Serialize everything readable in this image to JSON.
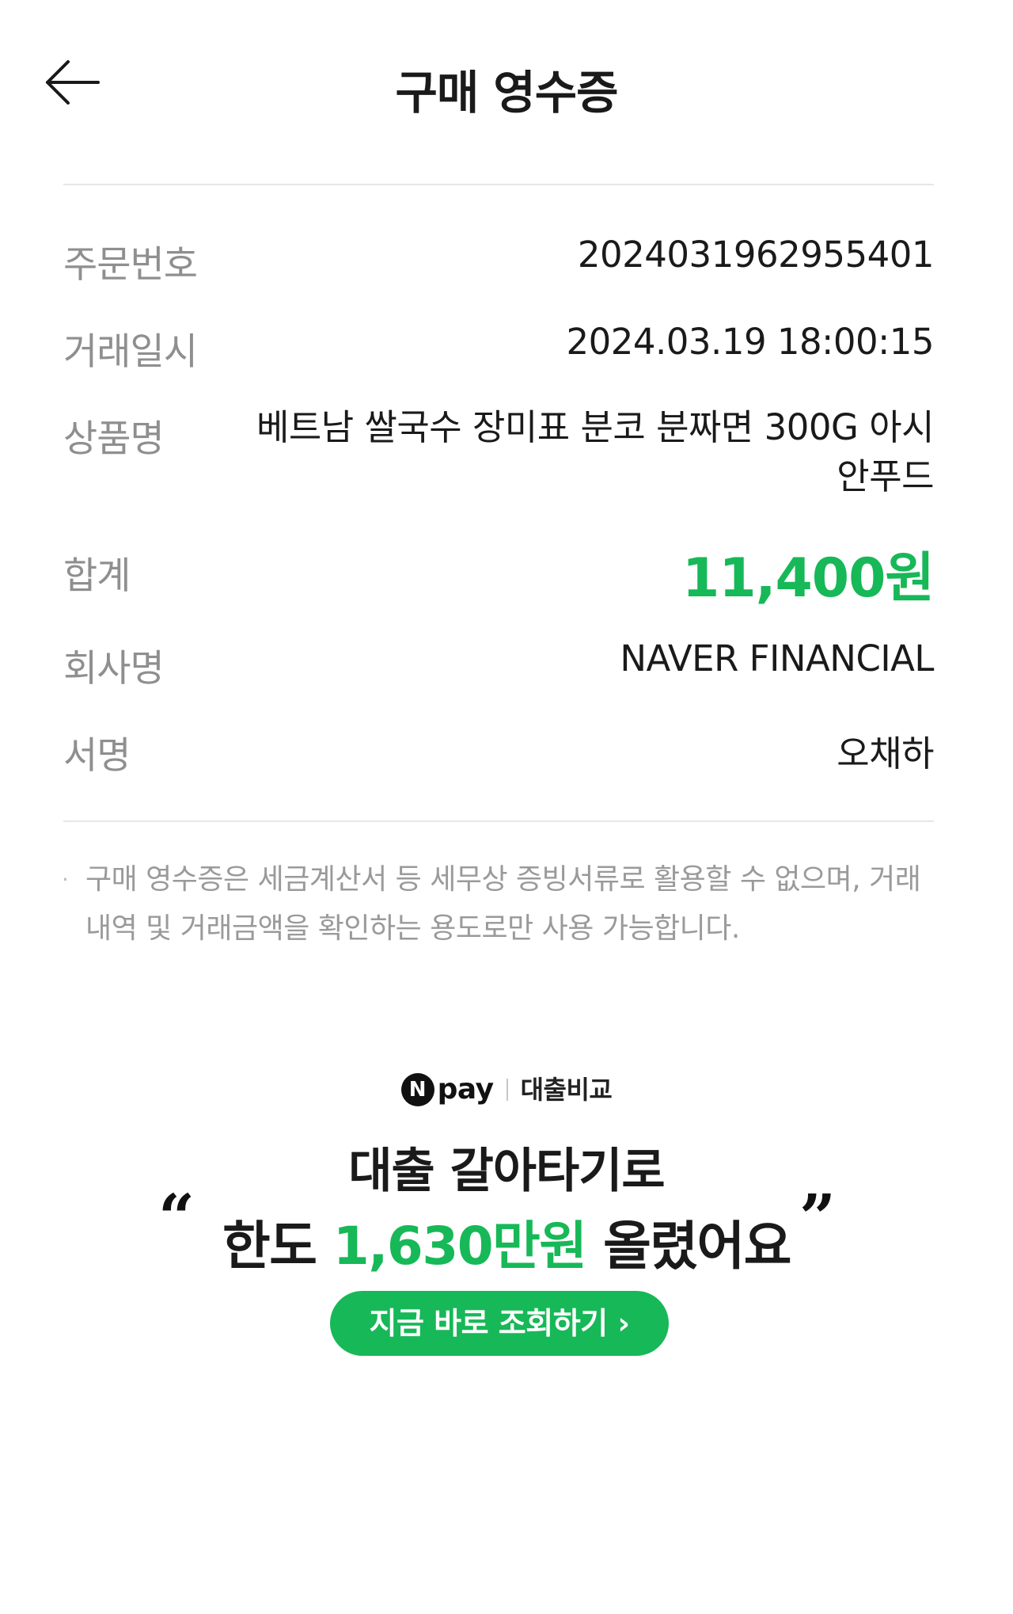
{
  "header": {
    "title": "구매 영수증"
  },
  "receipt": {
    "order_no": {
      "label": "주문번호",
      "value": "2024031962955401"
    },
    "datetime": {
      "label": "거래일시",
      "value": "2024.03.19 18:00:15"
    },
    "product": {
      "label": "상품명",
      "value": "베트남 쌀국수 장미표 분코 분짜면 300G 아시안푸드"
    },
    "total": {
      "label": "합계",
      "value": "11,400원"
    },
    "company": {
      "label": "회사명",
      "value": "NAVER FINANCIAL"
    },
    "signature": {
      "label": "서명",
      "value": "오채하"
    }
  },
  "notice": {
    "bullet": "·",
    "text": "구매 영수증은 세금계산서 등 세무상 증빙서류로 활용할 수 없으며, 거래 내역 및 거래금액을 확인하는 용도로만 사용 가능합니다."
  },
  "ad": {
    "logo_letter": "N",
    "brand": "pay",
    "service": "대출비교",
    "line1": "대출 갈아타기로",
    "line2_prefix": "한도 ",
    "line2_amount": "1,630만원",
    "line2_suffix": " 올렸어요",
    "open_quote": "“",
    "close_quote": "”",
    "cta": "지금 바로 조회하기 ›"
  },
  "colors": {
    "accent": "#17b857",
    "label": "#8f8f8f",
    "text": "#1a1a1a",
    "divider": "#e6e6e6"
  },
  "icons": {
    "back": "arrow-left-icon"
  }
}
